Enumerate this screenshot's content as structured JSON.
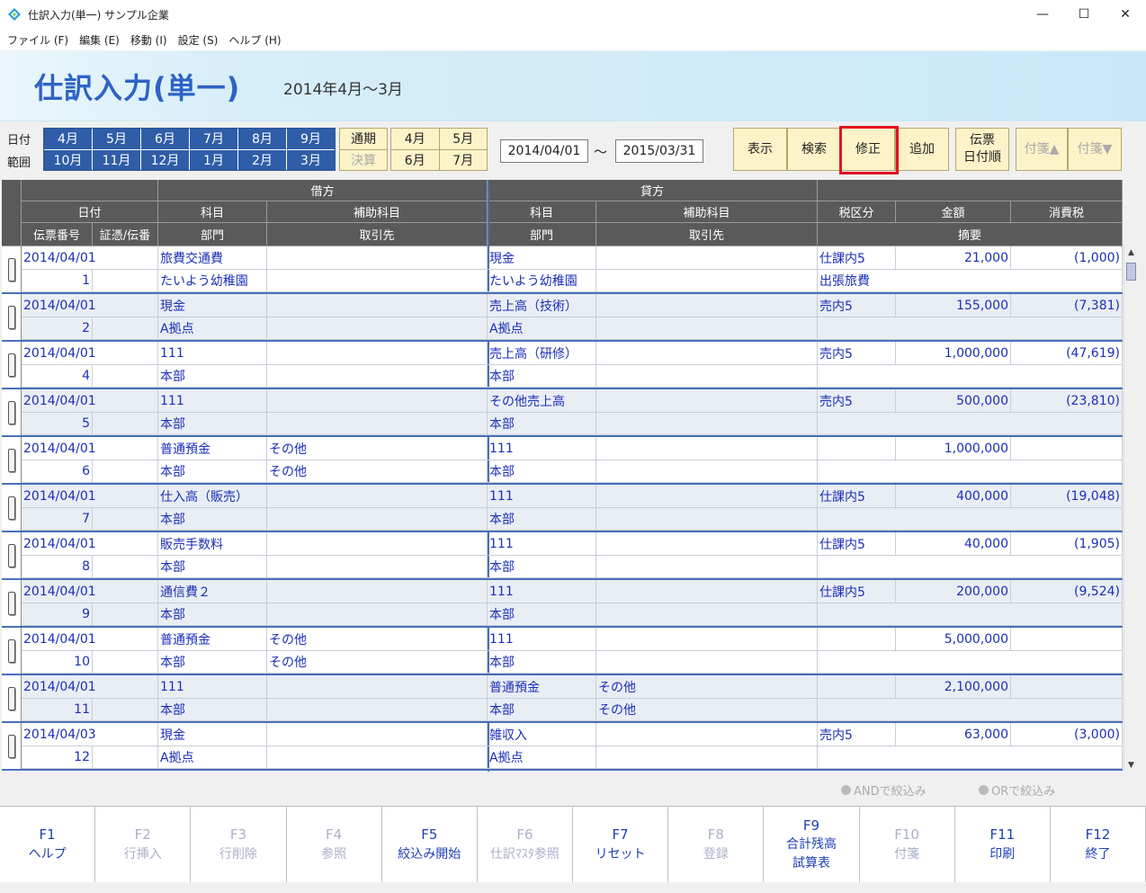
{
  "window": {
    "title": "仕訳入力(単一) サンプル企業",
    "min": "—",
    "max": "☐",
    "close": "✕"
  },
  "menu": [
    "ファイル (F)",
    "編集 (E)",
    "移動 (I)",
    "設定 (S)",
    "ヘルプ (H)"
  ],
  "header": {
    "title": "仕訳入力(単一)",
    "period": "2014年4月～3月"
  },
  "range": {
    "label1": "日付",
    "label2": "範囲",
    "months": [
      "4月",
      "5月",
      "6月",
      "7月",
      "8月",
      "9月",
      "10月",
      "11月",
      "12月",
      "1月",
      "2月",
      "3月"
    ],
    "period_buttons": [
      "通期",
      "決算"
    ],
    "quarter_buttons": [
      "4月",
      "5月",
      "6月",
      "7月"
    ],
    "date_from": "2014/04/01",
    "tilde": "～",
    "date_to": "2015/03/31"
  },
  "toolbar": {
    "display": "表示",
    "search": "検索",
    "edit": "修正",
    "add": "追加",
    "sort_line1": "伝票",
    "sort_line2": "日付順",
    "tag_up": "付箋▲",
    "tag_down": "付箋▼"
  },
  "columns": {
    "debit": "借方",
    "credit": "貸方",
    "date": "日付",
    "slip_no": "伝票番号",
    "voucher": "証憑/伝番",
    "account": "科目",
    "sub_account": "補助科目",
    "department": "部門",
    "partner": "取引先",
    "tax_class": "税区分",
    "amount": "金額",
    "tax": "消費税",
    "summary": "摘要"
  },
  "rows": [
    {
      "date": "2014/04/01",
      "no": "1",
      "d_acc": "旅費交通費",
      "d_sub": "",
      "d_dept": "たいよう幼稚園",
      "d_partner": "",
      "c_acc": "現金",
      "c_sub": "",
      "c_dept": "たいよう幼稚園",
      "c_partner": "",
      "tax_class": "仕課内5",
      "amount": "21,000",
      "tax": "(1,000)",
      "summary": "出張旅費"
    },
    {
      "date": "2014/04/01",
      "no": "2",
      "d_acc": "現金",
      "d_sub": "",
      "d_dept": "A拠点",
      "d_partner": "",
      "c_acc": "売上高（技術）",
      "c_sub": "",
      "c_dept": "A拠点",
      "c_partner": "",
      "tax_class": "売内5",
      "amount": "155,000",
      "tax": "(7,381)",
      "summary": ""
    },
    {
      "date": "2014/04/01",
      "no": "4",
      "d_acc": "111",
      "d_sub": "",
      "d_dept": "本部",
      "d_partner": "",
      "c_acc": "売上高（研修）",
      "c_sub": "",
      "c_dept": "本部",
      "c_partner": "",
      "tax_class": "売内5",
      "amount": "1,000,000",
      "tax": "(47,619)",
      "summary": ""
    },
    {
      "date": "2014/04/01",
      "no": "5",
      "d_acc": "111",
      "d_sub": "",
      "d_dept": "本部",
      "d_partner": "",
      "c_acc": "その他売上高",
      "c_sub": "",
      "c_dept": "本部",
      "c_partner": "",
      "tax_class": "売内5",
      "amount": "500,000",
      "tax": "(23,810)",
      "summary": ""
    },
    {
      "date": "2014/04/01",
      "no": "6",
      "d_acc": "普通預金",
      "d_sub": "その他",
      "d_dept": "本部",
      "d_partner": "その他",
      "c_acc": "111",
      "c_sub": "",
      "c_dept": "本部",
      "c_partner": "",
      "tax_class": "",
      "amount": "1,000,000",
      "tax": "",
      "summary": ""
    },
    {
      "date": "2014/04/01",
      "no": "7",
      "d_acc": "仕入高（販売）",
      "d_sub": "",
      "d_dept": "本部",
      "d_partner": "",
      "c_acc": "111",
      "c_sub": "",
      "c_dept": "本部",
      "c_partner": "",
      "tax_class": "仕課内5",
      "amount": "400,000",
      "tax": "(19,048)",
      "summary": ""
    },
    {
      "date": "2014/04/01",
      "no": "8",
      "d_acc": "販売手数料",
      "d_sub": "",
      "d_dept": "本部",
      "d_partner": "",
      "c_acc": "111",
      "c_sub": "",
      "c_dept": "本部",
      "c_partner": "",
      "tax_class": "仕課内5",
      "amount": "40,000",
      "tax": "(1,905)",
      "summary": ""
    },
    {
      "date": "2014/04/01",
      "no": "9",
      "d_acc": "通信費２",
      "d_sub": "",
      "d_dept": "本部",
      "d_partner": "",
      "c_acc": "111",
      "c_sub": "",
      "c_dept": "本部",
      "c_partner": "",
      "tax_class": "仕課内5",
      "amount": "200,000",
      "tax": "(9,524)",
      "summary": ""
    },
    {
      "date": "2014/04/01",
      "no": "10",
      "d_acc": "普通預金",
      "d_sub": "その他",
      "d_dept": "本部",
      "d_partner": "その他",
      "c_acc": "111",
      "c_sub": "",
      "c_dept": "本部",
      "c_partner": "",
      "tax_class": "",
      "amount": "5,000,000",
      "tax": "",
      "summary": ""
    },
    {
      "date": "2014/04/01",
      "no": "11",
      "d_acc": "111",
      "d_sub": "",
      "d_dept": "本部",
      "d_partner": "",
      "c_acc": "普通預金",
      "c_sub": "その他",
      "c_dept": "本部",
      "c_partner": "その他",
      "tax_class": "",
      "amount": "2,100,000",
      "tax": "",
      "summary": ""
    },
    {
      "date": "2014/04/03",
      "no": "12",
      "d_acc": "現金",
      "d_sub": "",
      "d_dept": "A拠点",
      "d_partner": "",
      "c_acc": "雑収入",
      "c_sub": "",
      "c_dept": "A拠点",
      "c_partner": "",
      "tax_class": "売内5",
      "amount": "63,000",
      "tax": "(3,000)",
      "summary": ""
    }
  ],
  "filters": {
    "and": "ANDで絞込み",
    "or": "ORで絞込み"
  },
  "fkeys": [
    {
      "key": "F1",
      "label": "ヘルプ",
      "enabled": true
    },
    {
      "key": "F2",
      "label": "行挿入",
      "enabled": false
    },
    {
      "key": "F3",
      "label": "行削除",
      "enabled": false
    },
    {
      "key": "F4",
      "label": "参照",
      "enabled": false
    },
    {
      "key": "F5",
      "label": "絞込み開始",
      "enabled": true
    },
    {
      "key": "F6",
      "label": "仕訳ﾏｽﾀ参照",
      "enabled": false
    },
    {
      "key": "F7",
      "label": "リセット",
      "enabled": true
    },
    {
      "key": "F8",
      "label": "登録",
      "enabled": false
    },
    {
      "key": "F9",
      "label": "合計残高",
      "label2": "試算表",
      "enabled": true
    },
    {
      "key": "F10",
      "label": "付箋",
      "enabled": false
    },
    {
      "key": "F11",
      "label": "印刷",
      "enabled": true
    },
    {
      "key": "F12",
      "label": "終了",
      "enabled": true
    }
  ],
  "colors": {
    "accent": "#2e63c5",
    "month_btn": "#2f5da8",
    "cell_text": "#1a2fb8",
    "highlight": "#e1141e",
    "button_bg": "#fdf3c9"
  }
}
